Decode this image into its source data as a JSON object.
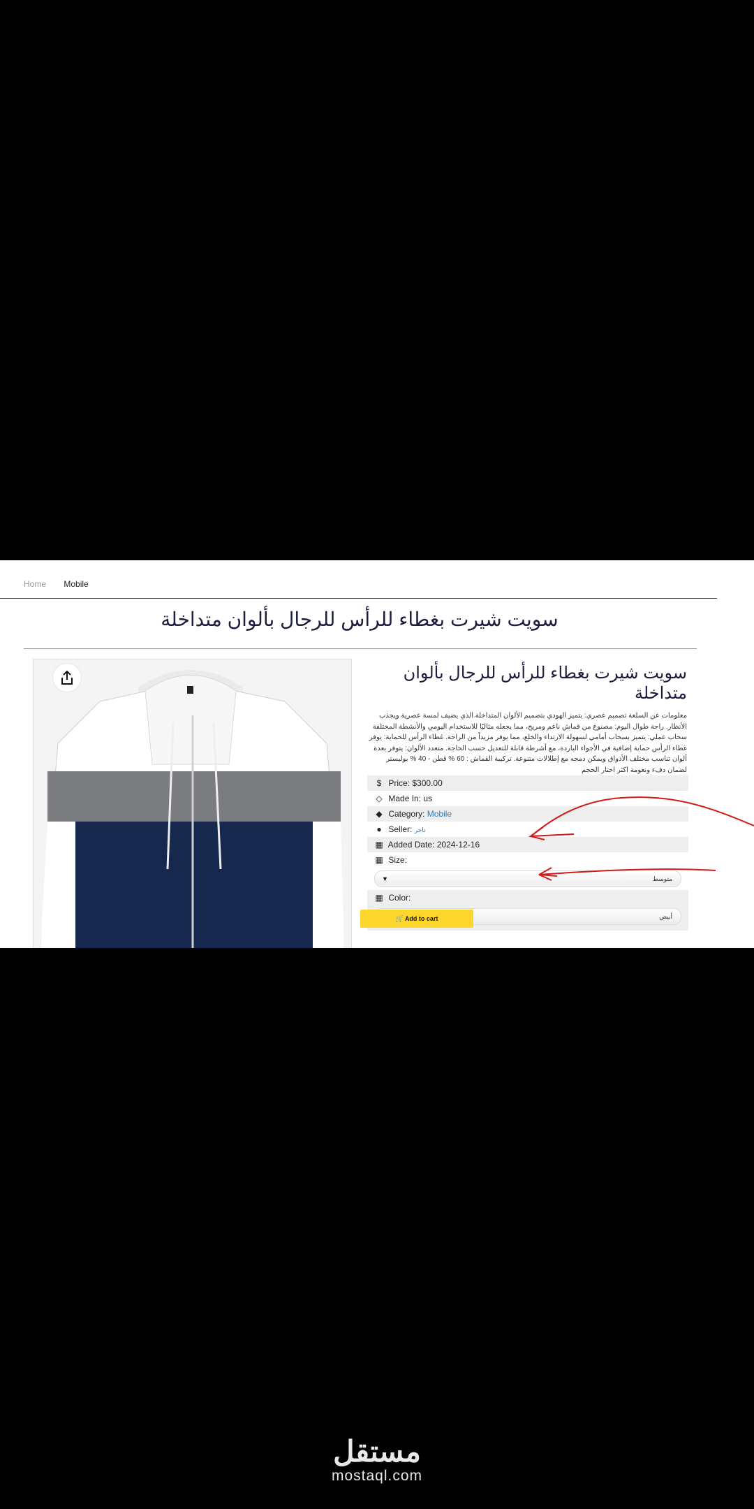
{
  "breadcrumb": {
    "home": "Home",
    "current": "Mobile"
  },
  "page_title": "سويت شيرت بغطاء للرأس للرجال بألوان متداخلة",
  "product": {
    "title": "سويت شيرت بغطاء للرأس للرجال بألوان متداخلة",
    "description": "معلومات عن السلعة تصميم عصري: يتميز الهودي بتصميم الألوان المتداخلة الذي يضيف لمسة عصرية ويجذب الأنظار. راحة طوال اليوم: مصنوع من قماش ناعم ومريح، مما يجعله مثاليًا للاستخدام اليومي والأنشطة المختلفة سحاب عملي: يتميز بسحاب أمامي لسهولة الارتداء والخلع، مما يوفر مزيداً من الراحة. غطاء الرأس للحماية: يوفر غطاء الرأس حماية إضافية في الأجواء الباردة، مع أشرطة قابلة للتعديل حسب الحاجة. متعدد الألوان: يتوفر بعدة ألوان تناسب مختلف الأذواق ويمكن دمجه مع إطلالات متنوعة. تركيبة القماش : 60 % قطن - 40 % بوليستر لضمان دفء ونعومة اكثر اختار الحجم",
    "price_label": "Price:",
    "price": "$300.00",
    "made_in_label": "Made In:",
    "made_in": "us",
    "category_label": "Category:",
    "category": "Mobile",
    "seller_label": "Seller:",
    "seller": "تاجر",
    "added_label": "Added Date:",
    "added_date": "2024-12-16",
    "size_label": "Size:",
    "size_value": "متوسط",
    "color_label": "Color:",
    "color_value": "أبيض",
    "add_to_cart": "Add to cart"
  },
  "icons": {
    "price": "dollar-icon",
    "made_in": "diamond-icon",
    "category": "tag-icon",
    "seller": "user-circle-icon",
    "date": "calendar-icon",
    "cart": "cart-icon",
    "share": "share-icon"
  },
  "watermark": {
    "arabic": "مستقل",
    "latin": "mostaql.com"
  },
  "colors": {
    "add_to_cart": "#fcd62b",
    "link": "#337ab7",
    "annotation": "#d11a1a",
    "hoodie_navy": "#16284e"
  }
}
